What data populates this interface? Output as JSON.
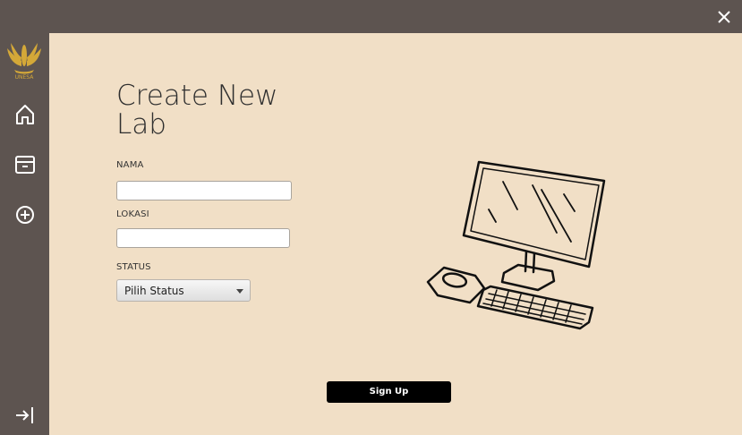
{
  "window": {
    "close_icon": "close-icon"
  },
  "sidebar": {
    "logo_text": "UNESA",
    "items": [
      {
        "name": "home",
        "icon": "home-icon"
      },
      {
        "name": "archive",
        "icon": "archive-icon"
      },
      {
        "name": "add",
        "icon": "plus-circle-icon"
      },
      {
        "name": "logout",
        "icon": "logout-icon"
      }
    ]
  },
  "form": {
    "title": "Create New\nLab",
    "nama_label": "NAMA",
    "nama_value": "",
    "lokasi_label": "LOKASI",
    "lokasi_value": "",
    "status_label": "STATUS",
    "status_selected": "Pilih Status",
    "submit_label": "Sign Up"
  },
  "illustration": {
    "icon": "computer-illustration"
  },
  "colors": {
    "sidebar": "#5d5450",
    "content_bg": "#f1dfc6",
    "button_bg": "#000000",
    "logo_gold": "#d4a838"
  }
}
